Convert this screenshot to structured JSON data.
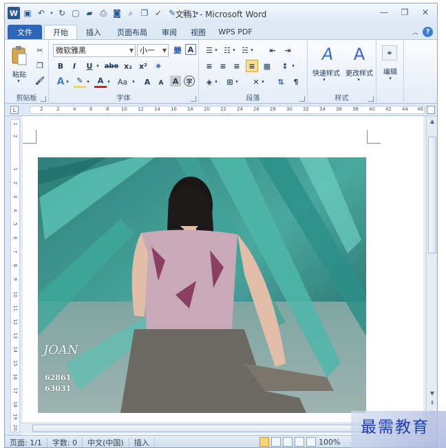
{
  "titlebar": {
    "title": "文档1 - Microsoft Word",
    "app_icon_letter": "W"
  },
  "tabs": [
    {
      "label": "文件"
    },
    {
      "label": "开始"
    },
    {
      "label": "插入"
    },
    {
      "label": "页面布局"
    },
    {
      "label": "审阅"
    },
    {
      "label": "视图"
    },
    {
      "label": "WPS PDF"
    }
  ],
  "ribbon": {
    "clipboard": {
      "paste_label": "粘贴",
      "group_label": "剪贴板"
    },
    "font": {
      "font_name": "微软雅黑",
      "font_size": "小一",
      "group_label": "字体",
      "bold": "B",
      "italic": "I",
      "underline": "U",
      "strike": "abe",
      "subscript": "x₂",
      "superscript": "x²",
      "grow": "A",
      "shrink": "A",
      "char_border": "A",
      "aa": "Aa"
    },
    "paragraph": {
      "group_label": "段落"
    },
    "styles": {
      "quick_styles_label": "快速样式",
      "change_styles_label": "更改样式",
      "group_label": "样式"
    },
    "editing": {
      "label": "编辑"
    }
  },
  "ruler": {
    "ticks": [
      "2",
      "2",
      "4",
      "6",
      "8",
      "10",
      "12",
      "14",
      "16",
      "18",
      "20",
      "22",
      "24",
      "26",
      "28",
      "30",
      "32",
      "34",
      "36",
      "38",
      "40",
      "42",
      "44",
      "46"
    ]
  },
  "vruler": {
    "ticks": [
      "1",
      "2",
      "1",
      "2",
      "3",
      "4",
      "5",
      "6",
      "7",
      "8",
      "9",
      "10",
      "11",
      "12",
      "13",
      "14",
      "15",
      "16",
      "17",
      "18",
      "19",
      "20"
    ]
  },
  "document": {
    "photo_caption_name": "JOAN",
    "photo_caption_num1": "62861",
    "photo_caption_num2": "63031"
  },
  "statusbar": {
    "page": "页面: 1/1",
    "words": "字数: 0",
    "language": "中文(中国)",
    "insert_mode": "插入",
    "zoom": "100%"
  },
  "watermark": {
    "text": "最需教育"
  },
  "colors": {
    "file_tab": "#2c66b8",
    "ribbon_bg": "#e4ecf6",
    "accent": "#1d3fae"
  }
}
